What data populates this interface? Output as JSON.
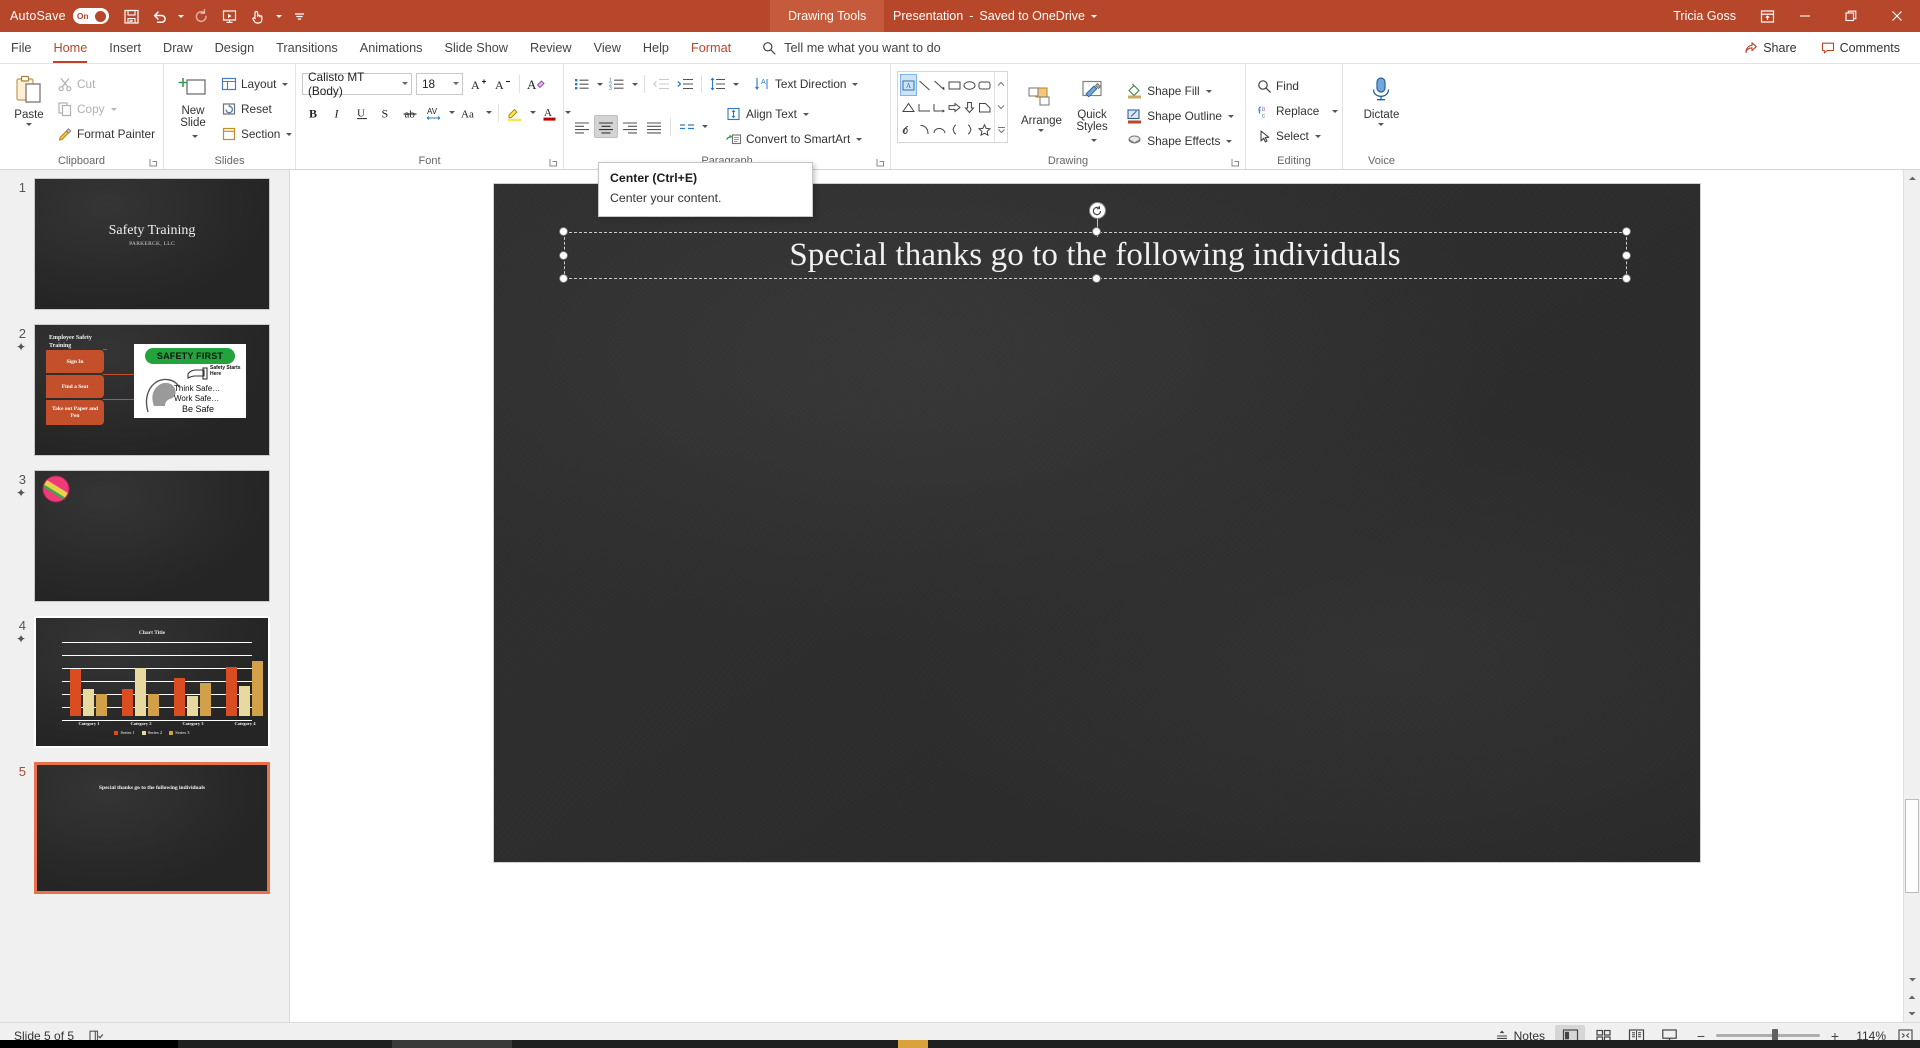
{
  "titlebar": {
    "autosave_label": "AutoSave",
    "autosave_state": "On",
    "qat": [
      {
        "name": "save-icon",
        "label": "Save"
      },
      {
        "name": "undo-icon",
        "label": "Undo"
      },
      {
        "name": "redo-icon",
        "label": "Redo"
      },
      {
        "name": "start-from-beginning-icon",
        "label": "Start From Beginning"
      },
      {
        "name": "touch-mode-icon",
        "label": "Touch/Mouse Mode"
      },
      {
        "name": "customize-quick-access-toolbar-icon",
        "label": "Customize Quick Access Toolbar"
      }
    ],
    "context_tab": "Drawing Tools",
    "document_title": "Presentation",
    "document_status": "Saved to OneDrive",
    "user_name": "Tricia Goss",
    "window_buttons": [
      "ribbon-display-options",
      "minimize",
      "restore",
      "close"
    ],
    "bg_color": "#b7472a",
    "context_bg_color": "#c55b3c"
  },
  "tabs": [
    {
      "label": "File",
      "active": false
    },
    {
      "label": "Home",
      "active": true
    },
    {
      "label": "Insert",
      "active": false
    },
    {
      "label": "Draw",
      "active": false
    },
    {
      "label": "Design",
      "active": false
    },
    {
      "label": "Transitions",
      "active": false
    },
    {
      "label": "Animations",
      "active": false
    },
    {
      "label": "Slide Show",
      "active": false
    },
    {
      "label": "Review",
      "active": false
    },
    {
      "label": "View",
      "active": false
    },
    {
      "label": "Help",
      "active": false
    },
    {
      "label": "Format",
      "active": false,
      "contextual": true
    }
  ],
  "tellme": {
    "placeholder": "Tell me what you want to do"
  },
  "share": {
    "label": "Share"
  },
  "comments": {
    "label": "Comments"
  },
  "ribbon": {
    "clipboard": {
      "group_label": "Clipboard",
      "paste_label": "Paste",
      "cut_label": "Cut",
      "copy_label": "Copy",
      "format_painter_label": "Format Painter"
    },
    "slides": {
      "group_label": "Slides",
      "new_slide_label": "New\nSlide",
      "new_slide_line1": "New",
      "new_slide_line2": "Slide",
      "layout_label": "Layout",
      "reset_label": "Reset",
      "section_label": "Section"
    },
    "font": {
      "group_label": "Font",
      "font_name": "Calisto MT (Body)",
      "font_size": "18",
      "grow_font": "A",
      "shrink_font": "A",
      "clear_formatting": "Clear All Formatting",
      "buttons": [
        "bold",
        "italic",
        "underline",
        "text-shadow",
        "strikethrough",
        "character-spacing",
        "change-case",
        "text-highlight-color",
        "font-color"
      ]
    },
    "paragraph": {
      "group_label": "Paragraph",
      "text_direction_label": "Text Direction",
      "align_text_label": "Align Text",
      "convert_smartart_label": "Convert to SmartArt",
      "buttons": [
        "bullets",
        "numbering",
        "decrease-indent",
        "increase-indent",
        "line-spacing",
        "align-left",
        "align-center",
        "align-right",
        "justify",
        "columns"
      ],
      "selected_button": "align-center"
    },
    "drawing": {
      "group_label": "Drawing",
      "arrange_label": "Arrange",
      "quick_styles_line1": "Quick",
      "quick_styles_line2": "Styles",
      "shape_fill_label": "Shape Fill",
      "shape_outline_label": "Shape Outline",
      "shape_effects_label": "Shape Effects"
    },
    "editing": {
      "group_label": "Editing",
      "find_label": "Find",
      "replace_label": "Replace",
      "select_label": "Select"
    },
    "voice": {
      "group_label": "Voice",
      "dictate_label": "Dictate"
    }
  },
  "tooltip": {
    "title": "Center (Ctrl+E)",
    "description": "Center your content."
  },
  "thumbnails": [
    {
      "number": "1",
      "animated": false,
      "selected": false,
      "kind": "title",
      "title": "Safety Training",
      "subtitle": "PARKERCK, LLC"
    },
    {
      "number": "2",
      "animated": true,
      "selected": false,
      "kind": "process",
      "heading": "Employee Safety Training",
      "steps": [
        "Sign In",
        "Find a Seat",
        "Take out Paper and Pen"
      ],
      "image_banner": "SAFETY FIRST",
      "image_lines": [
        "Think Safe…",
        "Work Safe…",
        "Be Safe"
      ],
      "image_badge": "Safety Starts Here"
    },
    {
      "number": "3",
      "animated": true,
      "selected": false,
      "kind": "image-only"
    },
    {
      "number": "4",
      "animated": true,
      "selected": false,
      "kind": "chart"
    },
    {
      "number": "5",
      "animated": false,
      "selected": true,
      "kind": "section",
      "title": "Special thanks go to the following individuals"
    }
  ],
  "slide": {
    "title_text": "Special thanks go to the following individuals",
    "selected": true,
    "background_color": "#2e2e2e"
  },
  "statusbar": {
    "slide_indicator": "Slide 5 of 5",
    "accessibility_icon": "accessibility-checker-icon",
    "notes_label": "Notes",
    "views": [
      {
        "name": "normal-view",
        "active": true
      },
      {
        "name": "slide-sorter-view",
        "active": false
      },
      {
        "name": "reading-view",
        "active": false
      },
      {
        "name": "slide-show-view",
        "active": false
      }
    ],
    "zoom_out": "−",
    "zoom_in": "+",
    "zoom_level": "114%",
    "fit_slide_icon": "fit-slide-to-window-icon"
  },
  "chart_data": {
    "type": "bar",
    "title": "Chart Title",
    "categories": [
      "Category 1",
      "Category 2",
      "Category 3",
      "Category 4"
    ],
    "series": [
      {
        "name": "Series 1",
        "values": [
          4.3,
          2.5,
          3.5,
          4.5
        ],
        "color": "#d94d20"
      },
      {
        "name": "Series 2",
        "values": [
          2.4,
          4.4,
          1.8,
          2.8
        ],
        "color": "#e8d9a0"
      },
      {
        "name": "Series 3",
        "values": [
          2.0,
          2.0,
          3.0,
          5.0
        ],
        "color": "#d3a04a"
      }
    ],
    "ylim": [
      0,
      6
    ],
    "grid": true,
    "legend": "bottom"
  }
}
